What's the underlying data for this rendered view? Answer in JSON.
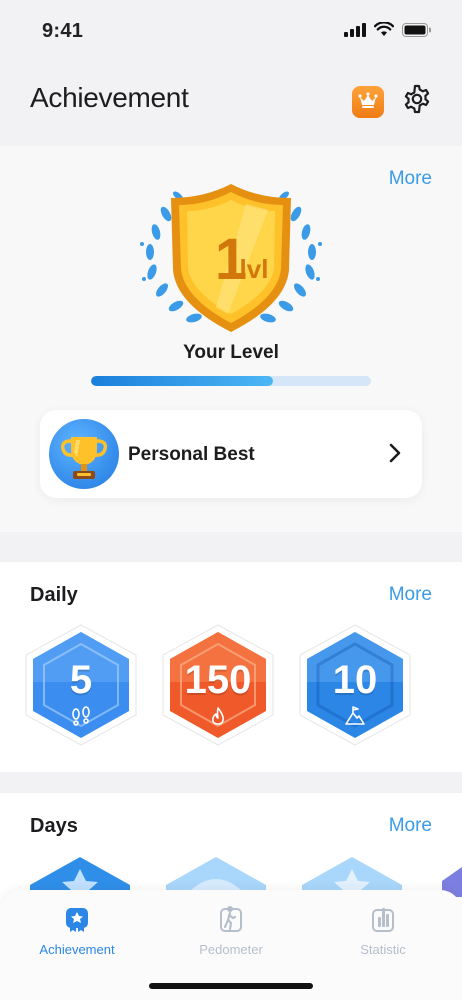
{
  "status": {
    "time": "9:41"
  },
  "header": {
    "title": "Achievement"
  },
  "level": {
    "more_label": "More",
    "badge_text": "1 lvl",
    "your_level_label": "Your Level",
    "progress": 0.65
  },
  "personal_best": {
    "label": "Personal Best"
  },
  "daily": {
    "title": "Daily",
    "more_label": "More",
    "badges": [
      {
        "value": "5",
        "icon": "footsteps-icon",
        "color": "#3b8df0"
      },
      {
        "value": "150",
        "icon": "flame-icon",
        "color": "#f0592a"
      },
      {
        "value": "10",
        "icon": "mountain-flag-icon",
        "color": "#2b86e6"
      }
    ]
  },
  "days": {
    "title": "Days",
    "more_label": "More"
  },
  "tabs": [
    {
      "label": "Achievement",
      "active": true
    },
    {
      "label": "Pedometer",
      "active": false
    },
    {
      "label": "Statistic",
      "active": false
    }
  ],
  "colors": {
    "accent": "#3a9be8",
    "tab_active": "#2b86e6",
    "tab_inactive": "#b5bfcc"
  }
}
